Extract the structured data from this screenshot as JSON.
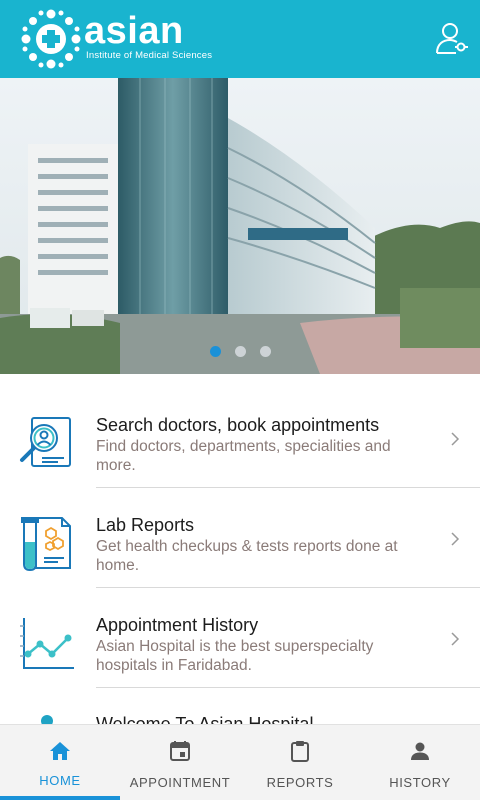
{
  "header": {
    "brand_name": "asian",
    "brand_subtitle": "Institute of Medical Sciences",
    "logo_icon": "asian-logo-icon",
    "profile_icon": "user-profile-icon",
    "accent_color": "#19b4cf"
  },
  "banner": {
    "image_icon": "hospital-building-image",
    "slides_total": 3,
    "active_slide": 1
  },
  "menu": {
    "items": [
      {
        "icon": "doctor-search-icon",
        "title": "Search doctors, book appointments",
        "description": "Find doctors, departments, specialities and more."
      },
      {
        "icon": "lab-reports-icon",
        "title": "Lab Reports",
        "description": "Get health checkups & tests reports done at home."
      },
      {
        "icon": "appointment-history-icon",
        "title": "Appointment History",
        "description": "Asian Hospital is the best superspecialty hospitals in Faridabad."
      },
      {
        "icon": "welcome-icon",
        "title": "Welcome To Asian Hospital"
      }
    ]
  },
  "bottom_nav": {
    "active_color": "#1992d8",
    "tabs": [
      {
        "label": "HOME",
        "icon": "home-icon",
        "active": true
      },
      {
        "label": "APPOINTMENT",
        "icon": "calendar-icon",
        "active": false
      },
      {
        "label": "REPORTS",
        "icon": "clipboard-icon",
        "active": false
      },
      {
        "label": "HISTORY",
        "icon": "person-icon",
        "active": false
      }
    ]
  }
}
